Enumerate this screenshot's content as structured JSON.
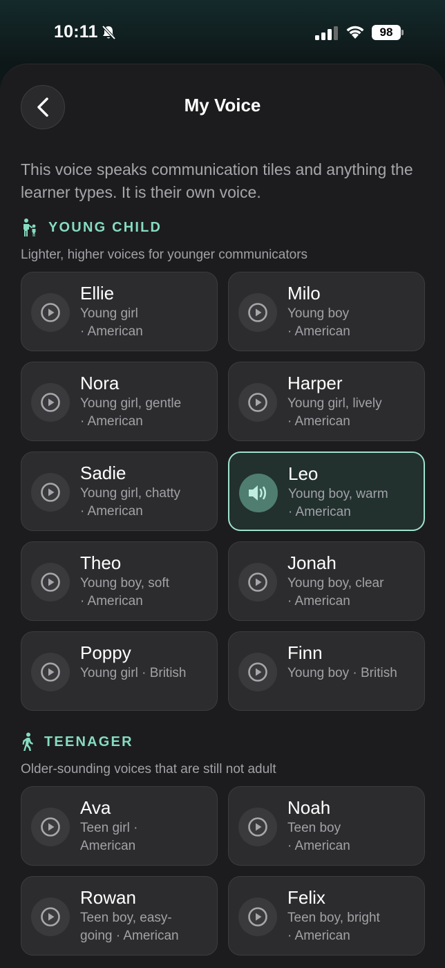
{
  "status_bar": {
    "time": "10:11",
    "battery": "98"
  },
  "header": {
    "title": "My Voice"
  },
  "intro": "This voice speaks communication tiles and anything the learner types. It is their own voice.",
  "sections": [
    {
      "label": "YOUNG CHILD",
      "icon": "parent-child-icon",
      "description": "Lighter, higher voices for younger communicators",
      "voices": [
        {
          "name": "Ellie",
          "description": "Young girl\n· American",
          "selected": false
        },
        {
          "name": "Milo",
          "description": "Young boy\n· American",
          "selected": false
        },
        {
          "name": "Nora",
          "description": "Young girl, gentle\n· American",
          "selected": false
        },
        {
          "name": "Harper",
          "description": "Young girl, lively\n· American",
          "selected": false
        },
        {
          "name": "Sadie",
          "description": "Young girl, chatty\n· American",
          "selected": false
        },
        {
          "name": "Leo",
          "description": "Young boy, warm\n· American",
          "selected": true
        },
        {
          "name": "Theo",
          "description": "Young boy, soft\n· American",
          "selected": false
        },
        {
          "name": "Jonah",
          "description": "Young boy, clear\n· American",
          "selected": false
        },
        {
          "name": "Poppy",
          "description": "Young girl · British",
          "selected": false
        },
        {
          "name": "Finn",
          "description": "Young boy · British",
          "selected": false
        }
      ]
    },
    {
      "label": "TEENAGER",
      "icon": "walking-person-icon",
      "description": "Older-sounding voices that are still not adult",
      "voices": [
        {
          "name": "Ava",
          "description": "Teen girl ·\nAmerican",
          "selected": false
        },
        {
          "name": "Noah",
          "description": "Teen boy\n· American",
          "selected": false
        },
        {
          "name": "Rowan",
          "description": "Teen boy, easy-\ngoing · American",
          "selected": false
        },
        {
          "name": "Felix",
          "description": "Teen boy, bright\n· American",
          "selected": false
        }
      ]
    }
  ],
  "colors": {
    "accent": "#86dcc0",
    "selected_border": "#9fe2cb",
    "tile": "#2c2c2e",
    "sheet": "#1c1c1e"
  }
}
